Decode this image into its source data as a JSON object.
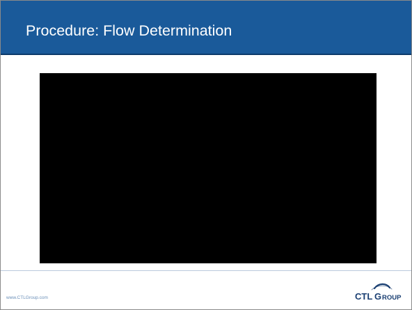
{
  "slide": {
    "title": "Procedure: Flow Determination",
    "footer_url": "www.CTLGroup.com",
    "logo_text": "CTLGROUP"
  },
  "colors": {
    "title_bar": "#1a5a9a",
    "title_text": "#ffffff",
    "video_frame": "#000000",
    "footer_text": "#6a8fb8",
    "logo": "#1a3f72"
  },
  "icons": {
    "logo": "ctlgroup-logo"
  }
}
